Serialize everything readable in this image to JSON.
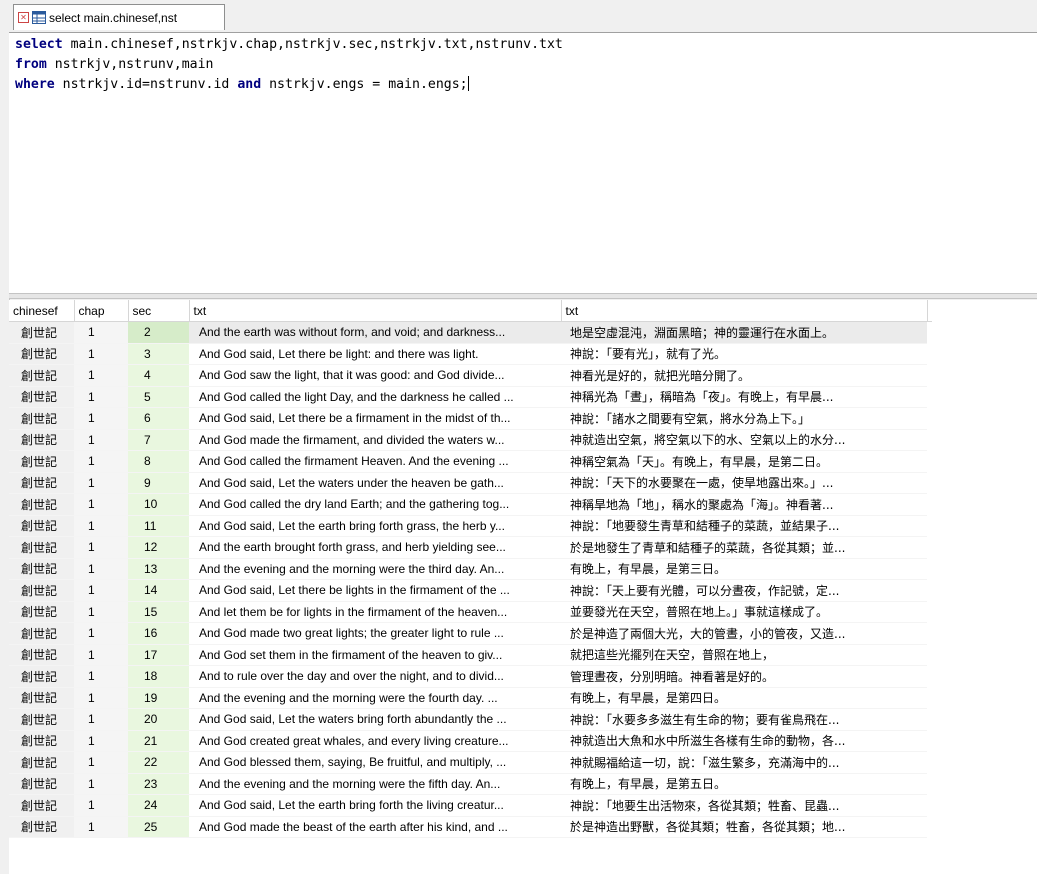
{
  "tab": {
    "title": "select main.chinesef,nst"
  },
  "editor": {
    "lines": [
      [
        {
          "t": "select",
          "k": true
        },
        {
          "t": " main.chinesef,nstrkjv.chap,nstrkjv.sec,nstrkjv.txt,nstrunv.txt",
          "k": false
        }
      ],
      [
        {
          "t": "from",
          "k": true
        },
        {
          "t": " nstrkjv,nstrunv,main",
          "k": false
        }
      ],
      [
        {
          "t": "where",
          "k": true
        },
        {
          "t": " nstrkjv.id=nstrunv.id ",
          "k": false
        },
        {
          "t": "and",
          "k": true
        },
        {
          "t": " nstrkjv.engs = main.engs;",
          "k": false
        }
      ]
    ]
  },
  "grid": {
    "columns": [
      "chinesef",
      "chap",
      "sec",
      "txt",
      "txt"
    ],
    "rows": [
      [
        "創世記",
        "1",
        "2",
        "And the earth was without form, and void; and darkness...",
        "地是空虛混沌，淵面黑暗；神的靈運行在水面上。"
      ],
      [
        "創世記",
        "1",
        "3",
        "And God said, Let there be light: and there was light.",
        "神說：「要有光」，就有了光。"
      ],
      [
        "創世記",
        "1",
        "4",
        "And God saw the light, that it was good: and God divide...",
        "神看光是好的，就把光暗分開了。"
      ],
      [
        "創世記",
        "1",
        "5",
        "And God called the light Day, and the darkness he called ...",
        "神稱光為「晝」，稱暗為「夜」。有晚上，有早晨..."
      ],
      [
        "創世記",
        "1",
        "6",
        "And God said, Let there be a firmament in the midst of th...",
        "神說：「諸水之間要有空氣，將水分為上下。」"
      ],
      [
        "創世記",
        "1",
        "7",
        "And God made the firmament, and divided the waters w...",
        "神就造出空氣，將空氣以下的水、空氣以上的水分..."
      ],
      [
        "創世記",
        "1",
        "8",
        "And God called the firmament Heaven. And the evening ...",
        "神稱空氣為「天」。有晚上，有早晨，是第二日。"
      ],
      [
        "創世記",
        "1",
        "9",
        "And God said, Let the waters under the heaven be gath...",
        "神說：「天下的水要聚在一處，使旱地露出來。」..."
      ],
      [
        "創世記",
        "1",
        "10",
        "And God called the dry land Earth; and the gathering tog...",
        "神稱旱地為「地」，稱水的聚處為「海」。神看著..."
      ],
      [
        "創世記",
        "1",
        "11",
        "And God said, Let the earth bring forth grass, the herb y...",
        "神說：「地要發生青草和結種子的菜蔬，並結果子..."
      ],
      [
        "創世記",
        "1",
        "12",
        "And the earth brought forth grass, and herb yielding see...",
        "於是地發生了青草和結種子的菜蔬，各從其類；並..."
      ],
      [
        "創世記",
        "1",
        "13",
        "And the evening and the morning were the third day. An...",
        "有晚上，有早晨，是第三日。"
      ],
      [
        "創世記",
        "1",
        "14",
        "And God said, Let there be lights in the firmament of the ...",
        "神說：「天上要有光體，可以分晝夜，作記號，定..."
      ],
      [
        "創世記",
        "1",
        "15",
        "And let them be for lights in the firmament of the heaven...",
        "並要發光在天空，普照在地上。」事就這樣成了。"
      ],
      [
        "創世記",
        "1",
        "16",
        "And God made two great lights; the greater light to rule ...",
        "於是神造了兩個大光，大的管晝，小的管夜，又造..."
      ],
      [
        "創世記",
        "1",
        "17",
        "And God set them in the firmament of the heaven to giv...",
        "就把這些光擺列在天空，普照在地上，"
      ],
      [
        "創世記",
        "1",
        "18",
        "And to rule over the day and over the night, and to divid...",
        "管理晝夜，分別明暗。神看著是好的。"
      ],
      [
        "創世記",
        "1",
        "19",
        "And the evening and the morning were the fourth day. ...",
        "有晚上，有早晨，是第四日。"
      ],
      [
        "創世記",
        "1",
        "20",
        "And God said, Let the waters bring forth abundantly the ...",
        "神說：「水要多多滋生有生命的物；要有雀鳥飛在..."
      ],
      [
        "創世記",
        "1",
        "21",
        "And God created great whales, and every living creature...",
        "神就造出大魚和水中所滋生各樣有生命的動物，各..."
      ],
      [
        "創世記",
        "1",
        "22",
        "And God blessed them, saying, Be fruitful, and multiply, ...",
        "神就賜福給這一切，說：「滋生繁多，充滿海中的..."
      ],
      [
        "創世記",
        "1",
        "23",
        "And the evening and the morning were the fifth day. An...",
        "有晚上，有早晨，是第五日。"
      ],
      [
        "創世記",
        "1",
        "24",
        "And God said, Let the earth bring forth the living creatur...",
        "神說：「地要生出活物來，各從其類；牲畜、昆蟲..."
      ],
      [
        "創世記",
        "1",
        "25",
        "And God made the beast of the earth after his kind, and ...",
        "於是神造出野獸，各從其類；牲畜，各從其類；地..."
      ]
    ]
  }
}
